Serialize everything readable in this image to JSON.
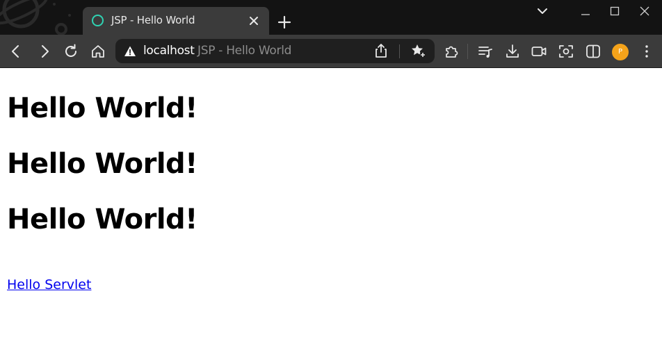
{
  "browser": {
    "tab": {
      "title": "JSP - Hello World",
      "favicon": "circle-icon",
      "favicon_color": "#2fd3b3"
    },
    "address_bar": {
      "security_icon": "warning-icon",
      "host": "localhost",
      "page_title": "JSP - Hello World"
    },
    "profile": {
      "initial": "P",
      "color": "#f5a31a"
    },
    "colors": {
      "tabstrip_bg": "#131313",
      "toolbar_bg": "#3b3b3b",
      "omnibox_bg": "#1f1f1f"
    }
  },
  "page": {
    "headings": [
      "Hello World!",
      "Hello World!",
      "Hello World!"
    ],
    "link_text": "Hello Servlet",
    "link_color": "#0000ee"
  }
}
